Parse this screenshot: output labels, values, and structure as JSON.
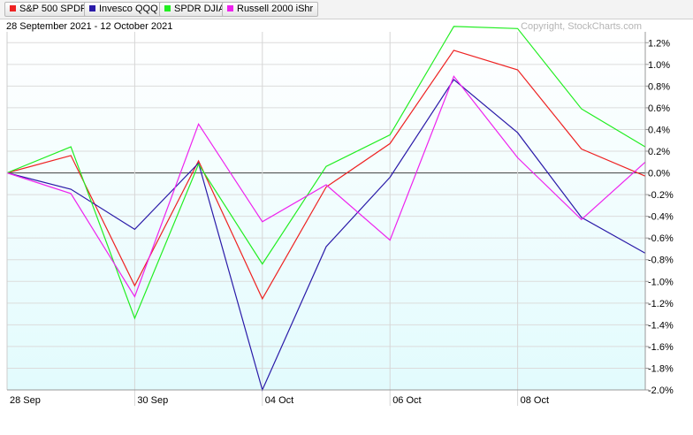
{
  "legend": {
    "items": [
      {
        "label": "S&P 500 SPDRs",
        "color": "#ee2222"
      },
      {
        "label": "Invesco QQQ",
        "color": "#2a1aa8"
      },
      {
        "label": "SPDR DJIA",
        "color": "#22ee22"
      },
      {
        "label": "Russell 2000 iShr",
        "color": "#ee22ee"
      }
    ]
  },
  "header": {
    "date_range": "28 September 2021 - 12 October 2021",
    "copyright": "Copyright, StockCharts.com"
  },
  "chart_data": {
    "type": "line",
    "x": [
      "28 Sep",
      "29 Sep",
      "30 Sep",
      "01 Oct",
      "04 Oct",
      "05 Oct",
      "06 Oct",
      "07 Oct",
      "08 Oct",
      "11 Oct",
      "12 Oct"
    ],
    "x_tick_labels": [
      "28  Sep",
      "30  Sep",
      "04  Oct",
      "06  Oct",
      "08  Oct"
    ],
    "x_tick_indices": [
      0,
      2,
      4,
      6,
      8
    ],
    "ylim": [
      -2.0,
      1.3
    ],
    "y_ticks": [
      1.2,
      1.0,
      0.8,
      0.6,
      0.4,
      0.2,
      0.0,
      -0.2,
      -0.4,
      -0.6,
      -0.8,
      -1.0,
      -1.2,
      -1.4,
      -1.6,
      -1.8,
      -2.0
    ],
    "y_tick_labels": [
      "1.2%",
      "1.0%",
      "0.8%",
      "0.6%",
      "0.4%",
      "0.2%",
      "0.0%",
      "-0.2%",
      "-0.4%",
      "-0.6%",
      "-0.8%",
      "-1.0%",
      "-1.2%",
      "-1.4%",
      "-1.6%",
      "-1.8%",
      "-2.0%"
    ],
    "y_axis_position": "right",
    "grid": true,
    "series": [
      {
        "name": "S&P 500 SPDRs",
        "color": "#ee2222",
        "values": [
          0.0,
          0.16,
          -1.04,
          0.11,
          -1.16,
          -0.13,
          0.27,
          1.13,
          0.95,
          0.22,
          -0.03
        ]
      },
      {
        "name": "Invesco QQQ",
        "color": "#2a1aa8",
        "values": [
          0.0,
          -0.15,
          -0.52,
          0.09,
          -2.0,
          -0.68,
          -0.04,
          0.86,
          0.37,
          -0.41,
          -0.74
        ]
      },
      {
        "name": "SPDR DJIA",
        "color": "#22ee22",
        "values": [
          0.0,
          0.24,
          -1.34,
          0.08,
          -0.84,
          0.06,
          0.35,
          1.35,
          1.33,
          0.59,
          0.24
        ]
      },
      {
        "name": "Russell 2000 iShr",
        "color": "#ee22ee",
        "values": [
          0.0,
          -0.19,
          -1.14,
          0.45,
          -0.45,
          -0.11,
          -0.62,
          0.89,
          0.14,
          -0.43,
          0.1
        ]
      }
    ]
  }
}
